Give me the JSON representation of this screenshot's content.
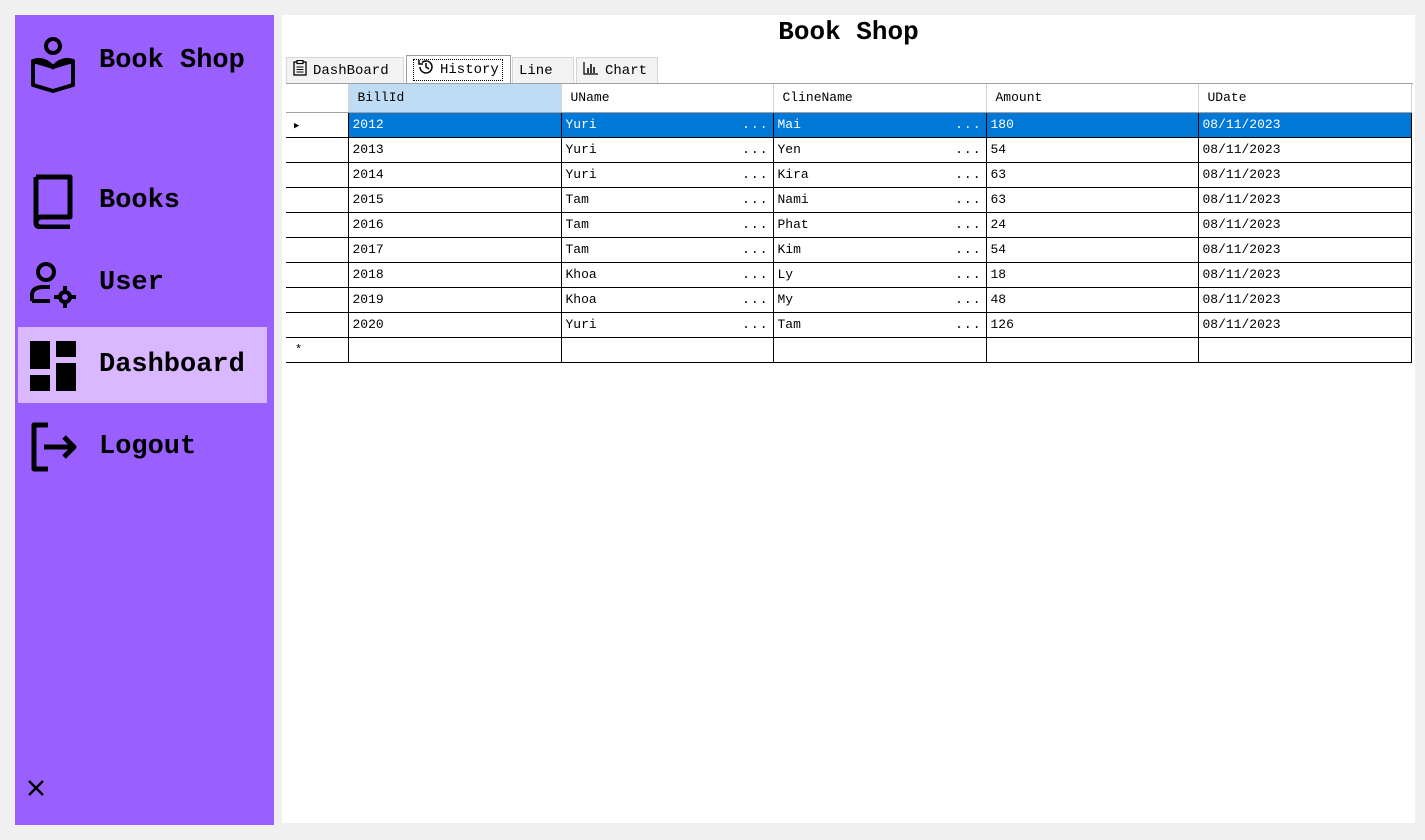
{
  "sidebar": {
    "brand": "Book Shop",
    "items": [
      {
        "label": "Books",
        "icon": "book-icon"
      },
      {
        "label": "User",
        "icon": "user-gear-icon"
      },
      {
        "label": "Dashboard",
        "icon": "dashboard-icon",
        "active": true
      },
      {
        "label": "Logout",
        "icon": "logout-icon"
      }
    ],
    "close_icon": "close-icon",
    "colors": {
      "background": "#9a5fff",
      "active": "#d9b8ff"
    }
  },
  "main": {
    "title": "Book Shop",
    "tabs": [
      {
        "label": "DashBoard",
        "icon": "clipboard-icon"
      },
      {
        "label": "History",
        "icon": "history-icon",
        "active": true
      },
      {
        "label": "Line",
        "icon": ""
      },
      {
        "label": "Chart",
        "icon": "bar-chart-icon"
      }
    ]
  },
  "grid": {
    "columns": [
      "BillId",
      "UName",
      "ClineName",
      "Amount",
      "UDate"
    ],
    "ellipsis": "...",
    "new_row_marker": "*",
    "selection_color": "#0078d7",
    "rows": [
      [
        "2012",
        "Yuri",
        "Mai",
        "180",
        "08/11/2023"
      ],
      [
        "2013",
        "Yuri",
        "Yen",
        "54",
        "08/11/2023"
      ],
      [
        "2014",
        "Yuri",
        "Kira",
        "63",
        "08/11/2023"
      ],
      [
        "2015",
        "Tam",
        "Nami",
        "63",
        "08/11/2023"
      ],
      [
        "2016",
        "Tam",
        "Phat",
        "24",
        "08/11/2023"
      ],
      [
        "2017",
        "Tam",
        "Kim",
        "54",
        "08/11/2023"
      ],
      [
        "2018",
        "Khoa",
        "Ly",
        "18",
        "08/11/2023"
      ],
      [
        "2019",
        "Khoa",
        "My",
        "48",
        "08/11/2023"
      ],
      [
        "2020",
        "Yuri",
        "Tam",
        "126",
        "08/11/2023"
      ]
    ]
  }
}
